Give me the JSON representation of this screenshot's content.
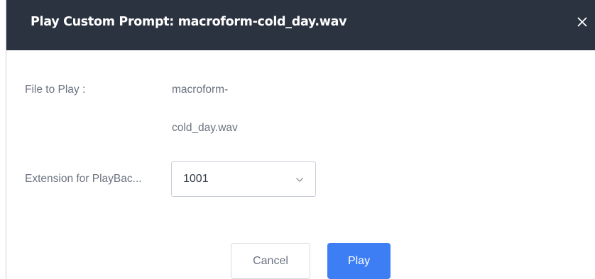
{
  "dialog": {
    "title": "Play Custom Prompt: macroform-cold_day.wav",
    "close_icon": "close-icon"
  },
  "form": {
    "file_label": "File to Play :",
    "file_value_line1": "macroform-",
    "file_value_line2": "cold_day.wav",
    "extension_label": "Extension for PlayBac...",
    "extension_selected": "1001",
    "extension_icon": "chevron-down-icon"
  },
  "buttons": {
    "cancel_label": "Cancel",
    "play_label": "Play"
  },
  "colors": {
    "titlebar": "#2b3240",
    "primary": "#3d7ef5",
    "text_muted": "#6b7280"
  }
}
